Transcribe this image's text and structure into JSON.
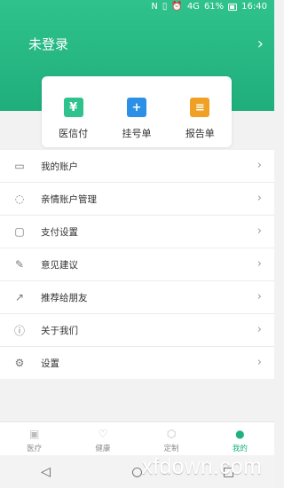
{
  "status_bar": {
    "nfc": "N",
    "vibrate": "▯",
    "alarm": "⏰",
    "network": "4G",
    "battery_percent": "61%",
    "time": "16:40"
  },
  "header": {
    "login_text": "未登录"
  },
  "quick_actions": [
    {
      "label": "医信付",
      "icon": "wallet-icon",
      "color": "#2fc28c"
    },
    {
      "label": "挂号单",
      "icon": "plus-icon",
      "color": "#2b90e6"
    },
    {
      "label": "报告单",
      "icon": "report-icon",
      "color": "#f0a125"
    }
  ],
  "menu": [
    {
      "label": "我的账户",
      "icon": "card-icon"
    },
    {
      "label": "亲情账户管理",
      "icon": "family-icon"
    },
    {
      "label": "支付设置",
      "icon": "wallet-icon"
    },
    {
      "label": "意见建议",
      "icon": "edit-icon"
    },
    {
      "label": "推荐给朋友",
      "icon": "share-icon"
    },
    {
      "label": "关于我们",
      "icon": "info-icon"
    },
    {
      "label": "设置",
      "icon": "gear-icon"
    }
  ],
  "bottom_nav": [
    {
      "label": "医疗",
      "icon": "medical-box-icon",
      "active": false
    },
    {
      "label": "健康",
      "icon": "heart-pulse-icon",
      "active": false
    },
    {
      "label": "定制",
      "icon": "package-icon",
      "active": false
    },
    {
      "label": "我的",
      "icon": "person-icon",
      "active": true
    }
  ],
  "watermark": "xfdown.com",
  "colors": {
    "brand_green": "#1fb17f",
    "hero_green": "#2fc28c",
    "blue": "#2b90e6",
    "orange": "#f0a125"
  }
}
